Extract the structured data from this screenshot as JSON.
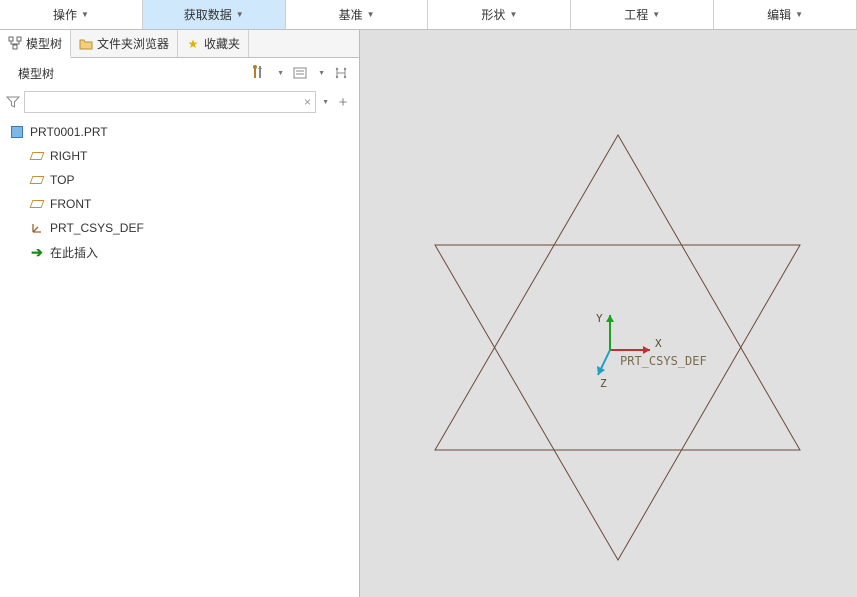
{
  "ribbon": {
    "tabs": [
      {
        "label": "操作"
      },
      {
        "label": "获取数据"
      },
      {
        "label": "基准"
      },
      {
        "label": "形状"
      },
      {
        "label": "工程"
      },
      {
        "label": "编辑"
      }
    ],
    "active_index": 1
  },
  "subtabs": {
    "items": [
      {
        "label": "模型树"
      },
      {
        "label": "文件夹浏览器"
      },
      {
        "label": "收藏夹"
      }
    ],
    "active_index": 0
  },
  "panel": {
    "title": "模型树"
  },
  "filter": {
    "placeholder": ""
  },
  "tree": {
    "root": {
      "label": "PRT0001.PRT"
    },
    "children": [
      {
        "type": "plane",
        "label": "RIGHT"
      },
      {
        "type": "plane",
        "label": "TOP"
      },
      {
        "type": "plane",
        "label": "FRONT"
      },
      {
        "type": "csys",
        "label": "PRT_CSYS_DEF"
      },
      {
        "type": "insert",
        "label": "在此插入"
      }
    ]
  },
  "viewport": {
    "csys_label": "PRT_CSYS_DEF",
    "axes": {
      "x": "X",
      "y": "Y",
      "z": "Z"
    }
  }
}
